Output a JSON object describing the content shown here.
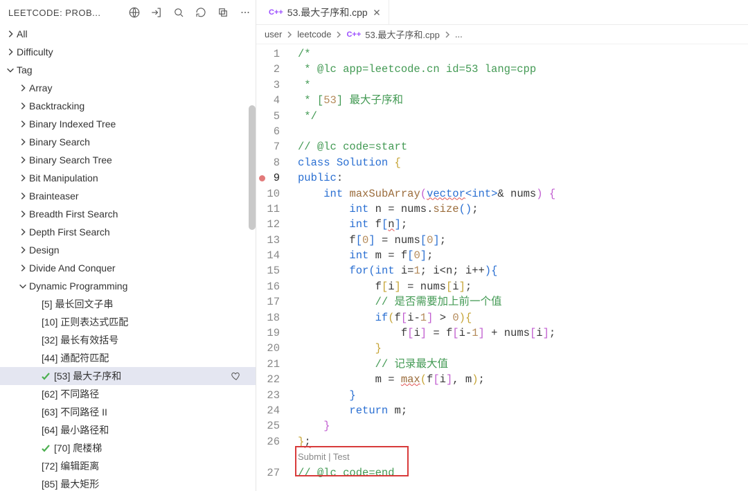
{
  "sidebar": {
    "title": "LEETCODE: PROB...",
    "top_nodes": [
      {
        "label": "All",
        "expanded": false,
        "indent": 0
      },
      {
        "label": "Difficulty",
        "expanded": false,
        "indent": 0
      },
      {
        "label": "Tag",
        "expanded": true,
        "indent": 0
      }
    ],
    "tag_children": [
      {
        "label": "Array",
        "indent": 1
      },
      {
        "label": "Backtracking",
        "indent": 1
      },
      {
        "label": "Binary Indexed Tree",
        "indent": 1
      },
      {
        "label": "Binary Search",
        "indent": 1
      },
      {
        "label": "Binary Search Tree",
        "indent": 1
      },
      {
        "label": "Bit Manipulation",
        "indent": 1
      },
      {
        "label": "Brainteaser",
        "indent": 1
      },
      {
        "label": "Breadth First Search",
        "indent": 1
      },
      {
        "label": "Depth First Search",
        "indent": 1
      },
      {
        "label": "Design",
        "indent": 1
      },
      {
        "label": "Divide And Conquer",
        "indent": 1
      },
      {
        "label": "Dynamic Programming",
        "indent": 1,
        "expanded": true
      }
    ],
    "dp_children": [
      {
        "label": "[5] 最长回文子串"
      },
      {
        "label": "[10] 正则表达式匹配"
      },
      {
        "label": "[32] 最长有效括号"
      },
      {
        "label": "[44] 通配符匹配"
      },
      {
        "label": "[53] 最大子序和",
        "selected": true,
        "check": true,
        "heart": true
      },
      {
        "label": "[62] 不同路径"
      },
      {
        "label": "[63] 不同路径 II"
      },
      {
        "label": "[64] 最小路径和"
      },
      {
        "label": "[70] 爬楼梯",
        "check": true
      },
      {
        "label": "[72] 编辑距离"
      },
      {
        "label": "[85] 最大矩形"
      }
    ]
  },
  "tab": {
    "icon": "C++",
    "name": "53.最大子序和.cpp"
  },
  "breadcrumbs": {
    "items": [
      "user",
      "leetcode"
    ],
    "file_icon": "C++",
    "file": "53.最大子序和.cpp",
    "tail": "..."
  },
  "codelens": {
    "text": "Submit | Test"
  },
  "code": {
    "lines": [
      {
        "n": 1,
        "segs": [
          {
            "t": "/*",
            "c": "c-comment"
          }
        ]
      },
      {
        "n": 2,
        "segs": [
          {
            "t": " * @lc app=leetcode.cn id=53 lang=cpp",
            "c": "c-comment"
          }
        ]
      },
      {
        "n": 3,
        "segs": [
          {
            "t": " *",
            "c": "c-comment"
          }
        ]
      },
      {
        "n": 4,
        "segs": [
          {
            "t": " * ",
            "c": "c-comment"
          },
          {
            "t": "[",
            "c": "c-comment"
          },
          {
            "t": "53",
            "c": "c-num"
          },
          {
            "t": "]",
            "c": "c-comment"
          },
          {
            "t": " 最大子序和",
            "c": "c-comment"
          }
        ]
      },
      {
        "n": 5,
        "segs": [
          {
            "t": " */",
            "c": "c-comment"
          }
        ]
      },
      {
        "n": 6,
        "segs": [
          {
            "t": " "
          }
        ]
      },
      {
        "n": 7,
        "segs": [
          {
            "t": "// @lc code=start",
            "c": "c-comment"
          }
        ]
      },
      {
        "n": 8,
        "segs": [
          {
            "t": "class ",
            "c": "c-kw"
          },
          {
            "t": "Solution",
            "c": "c-type"
          },
          {
            "t": " "
          },
          {
            "t": "{",
            "c": "c-brace-gold"
          }
        ]
      },
      {
        "n": 9,
        "bp": true,
        "active": true,
        "segs": [
          {
            "t": "public",
            "c": "c-kw"
          },
          {
            "t": ":",
            "c": "c-punc"
          }
        ]
      },
      {
        "n": 10,
        "segs": [
          {
            "t": "    "
          },
          {
            "t": "int ",
            "c": "c-kw"
          },
          {
            "t": "maxSubArray",
            "c": "c-fn"
          },
          {
            "t": "(",
            "c": "c-brace-pink"
          },
          {
            "t": "vector",
            "c": "c-type squiggle"
          },
          {
            "t": "<",
            "c": "c-brace-blue"
          },
          {
            "t": "int",
            "c": "c-kw"
          },
          {
            "t": ">",
            "c": "c-brace-blue"
          },
          {
            "t": "& nums",
            "c": "c-punc"
          },
          {
            "t": ")",
            "c": "c-brace-pink"
          },
          {
            "t": " "
          },
          {
            "t": "{",
            "c": "c-brace-pink"
          }
        ]
      },
      {
        "n": 11,
        "segs": [
          {
            "t": "        "
          },
          {
            "t": "int ",
            "c": "c-kw"
          },
          {
            "t": "n = nums"
          },
          {
            "t": ".",
            "c": "c-punc"
          },
          {
            "t": "size",
            "c": "c-fn"
          },
          {
            "t": "(",
            "c": "c-brace-blue"
          },
          {
            "t": ")",
            "c": "c-brace-blue"
          },
          {
            "t": ";"
          }
        ]
      },
      {
        "n": 12,
        "segs": [
          {
            "t": "        "
          },
          {
            "t": "int ",
            "c": "c-kw"
          },
          {
            "t": "f"
          },
          {
            "t": "[",
            "c": "c-brace-blue"
          },
          {
            "t": "n",
            "c": "squiggle"
          },
          {
            "t": "]",
            "c": "c-brace-blue"
          },
          {
            "t": ";"
          }
        ]
      },
      {
        "n": 13,
        "segs": [
          {
            "t": "        f"
          },
          {
            "t": "[",
            "c": "c-brace-blue"
          },
          {
            "t": "0",
            "c": "c-num"
          },
          {
            "t": "]",
            "c": "c-brace-blue"
          },
          {
            "t": " = nums"
          },
          {
            "t": "[",
            "c": "c-brace-blue"
          },
          {
            "t": "0",
            "c": "c-num"
          },
          {
            "t": "]",
            "c": "c-brace-blue"
          },
          {
            "t": ";"
          }
        ]
      },
      {
        "n": 14,
        "segs": [
          {
            "t": "        "
          },
          {
            "t": "int ",
            "c": "c-kw"
          },
          {
            "t": "m = f"
          },
          {
            "t": "[",
            "c": "c-brace-blue"
          },
          {
            "t": "0",
            "c": "c-num"
          },
          {
            "t": "]",
            "c": "c-brace-blue"
          },
          {
            "t": ";"
          }
        ]
      },
      {
        "n": 15,
        "segs": [
          {
            "t": "        "
          },
          {
            "t": "for",
            "c": "c-kw"
          },
          {
            "t": "(",
            "c": "c-brace-blue"
          },
          {
            "t": "int ",
            "c": "c-kw"
          },
          {
            "t": "i="
          },
          {
            "t": "1",
            "c": "c-num"
          },
          {
            "t": "; i<n; i++"
          },
          {
            "t": ")",
            "c": "c-brace-blue"
          },
          {
            "t": "{",
            "c": "c-brace-blue"
          }
        ]
      },
      {
        "n": 16,
        "segs": [
          {
            "t": "            f"
          },
          {
            "t": "[",
            "c": "c-brace-gold"
          },
          {
            "t": "i"
          },
          {
            "t": "]",
            "c": "c-brace-gold"
          },
          {
            "t": " = nums"
          },
          {
            "t": "[",
            "c": "c-brace-gold"
          },
          {
            "t": "i"
          },
          {
            "t": "]",
            "c": "c-brace-gold"
          },
          {
            "t": ";"
          }
        ]
      },
      {
        "n": 17,
        "segs": [
          {
            "t": "            "
          },
          {
            "t": "// 是否需要加上前一个值",
            "c": "c-comment"
          }
        ]
      },
      {
        "n": 18,
        "segs": [
          {
            "t": "            "
          },
          {
            "t": "if",
            "c": "c-kw"
          },
          {
            "t": "(",
            "c": "c-brace-gold"
          },
          {
            "t": "f"
          },
          {
            "t": "[",
            "c": "c-brace-pink"
          },
          {
            "t": "i-"
          },
          {
            "t": "1",
            "c": "c-num"
          },
          {
            "t": "]",
            "c": "c-brace-pink"
          },
          {
            "t": " > "
          },
          {
            "t": "0",
            "c": "c-num"
          },
          {
            "t": ")",
            "c": "c-brace-gold"
          },
          {
            "t": "{",
            "c": "c-brace-gold"
          }
        ]
      },
      {
        "n": 19,
        "segs": [
          {
            "t": "                f"
          },
          {
            "t": "[",
            "c": "c-brace-pink"
          },
          {
            "t": "i"
          },
          {
            "t": "]",
            "c": "c-brace-pink"
          },
          {
            "t": " = f"
          },
          {
            "t": "[",
            "c": "c-brace-pink"
          },
          {
            "t": "i-"
          },
          {
            "t": "1",
            "c": "c-num"
          },
          {
            "t": "]",
            "c": "c-brace-pink"
          },
          {
            "t": " + nums"
          },
          {
            "t": "[",
            "c": "c-brace-pink"
          },
          {
            "t": "i"
          },
          {
            "t": "]",
            "c": "c-brace-pink"
          },
          {
            "t": ";"
          }
        ]
      },
      {
        "n": 20,
        "segs": [
          {
            "t": "            "
          },
          {
            "t": "}",
            "c": "c-brace-gold"
          }
        ]
      },
      {
        "n": 21,
        "segs": [
          {
            "t": "            "
          },
          {
            "t": "// 记录最大值",
            "c": "c-comment"
          }
        ]
      },
      {
        "n": 22,
        "segs": [
          {
            "t": "            m = "
          },
          {
            "t": "max",
            "c": "c-fn squiggle"
          },
          {
            "t": "(",
            "c": "c-brace-gold"
          },
          {
            "t": "f"
          },
          {
            "t": "[",
            "c": "c-brace-pink"
          },
          {
            "t": "i"
          },
          {
            "t": "]",
            "c": "c-brace-pink"
          },
          {
            "t": ", m"
          },
          {
            "t": ")",
            "c": "c-brace-gold"
          },
          {
            "t": ";"
          }
        ]
      },
      {
        "n": 23,
        "segs": [
          {
            "t": "        "
          },
          {
            "t": "}",
            "c": "c-brace-blue"
          }
        ]
      },
      {
        "n": 24,
        "segs": [
          {
            "t": "        "
          },
          {
            "t": "return ",
            "c": "c-kw"
          },
          {
            "t": "m;"
          }
        ]
      },
      {
        "n": 25,
        "segs": [
          {
            "t": "    "
          },
          {
            "t": "}",
            "c": "c-brace-pink"
          }
        ]
      },
      {
        "n": 26,
        "segs": [
          {
            "t": "}",
            "c": "c-brace-gold"
          },
          {
            "t": ";",
            "c": "squiggle"
          }
        ]
      },
      {
        "n": 27,
        "segs": [
          {
            "t": "// @lc code=end",
            "c": "c-comment"
          }
        ]
      }
    ]
  }
}
